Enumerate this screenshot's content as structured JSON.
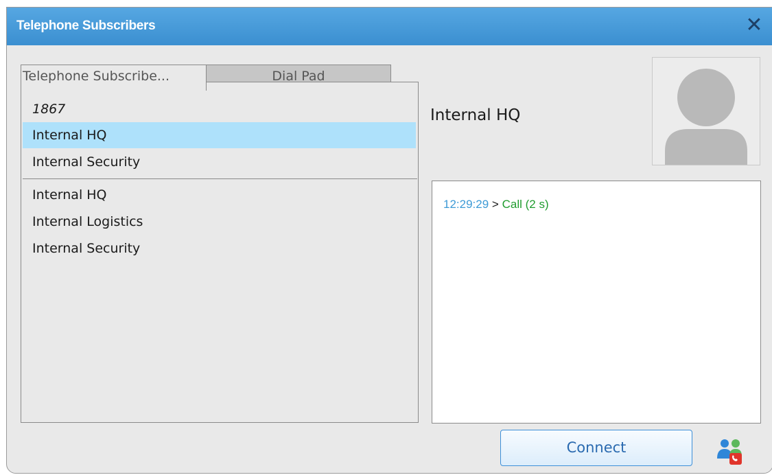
{
  "window": {
    "title": "Telephone Subscribers"
  },
  "tabs": [
    {
      "label": "Telephone Subscribe...",
      "active": true
    },
    {
      "label": "Dial Pad",
      "active": false
    }
  ],
  "recent_list": [
    {
      "label": "1867",
      "italic": true,
      "selected": false
    },
    {
      "label": "Internal HQ",
      "italic": false,
      "selected": true
    },
    {
      "label": "Internal Security",
      "italic": false,
      "selected": false
    }
  ],
  "subscribers": [
    {
      "label": "Internal HQ"
    },
    {
      "label": "Internal Logistics"
    },
    {
      "label": "Internal Security"
    }
  ],
  "contact": {
    "name": "Internal HQ"
  },
  "log": [
    {
      "time": "12:29:29",
      "separator": ">",
      "event": "Call (2 s)"
    }
  ],
  "actions": {
    "connect_label": "Connect"
  },
  "icons": {
    "close": "close-icon",
    "avatar": "user-silhouette-icon",
    "call_subscribers": "subscribers-call-icon"
  },
  "colors": {
    "titlebar": "#4a9ddc",
    "selected_row": "#aee1fb",
    "log_time": "#3d9ad6",
    "log_event": "#1f9c2e",
    "button_text": "#2a6ab0"
  }
}
